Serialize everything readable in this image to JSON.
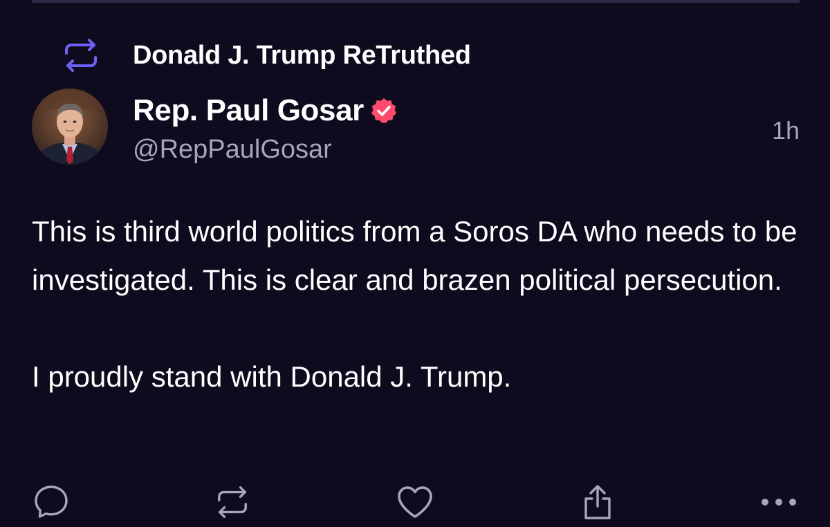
{
  "retruth": {
    "label": "Donald J. Trump ReTruthed",
    "icon": "retruth-icon",
    "icon_color": "#6e62f6"
  },
  "author": {
    "name": "Rep. Paul Gosar",
    "handle": "@RepPaulGosar",
    "verified": true,
    "verified_color": "#ff4a6c",
    "avatar": "avatar"
  },
  "post": {
    "timestamp": "1h",
    "paragraphs": [
      "This is third world politics from a Soros DA who needs to be investigated. This is clear and brazen political persecution.",
      "I proudly stand with Donald J. Trump."
    ]
  },
  "actions": [
    {
      "name": "reply",
      "icon": "comment-icon"
    },
    {
      "name": "retruth",
      "icon": "retruth-icon"
    },
    {
      "name": "like",
      "icon": "heart-icon"
    },
    {
      "name": "share",
      "icon": "share-icon"
    },
    {
      "name": "more",
      "icon": "more-icon"
    }
  ],
  "colors": {
    "background": "#0e0b1e",
    "text_primary": "#ffffff",
    "text_secondary": "#a7a5b8",
    "action_icon": "#a7a5b8"
  }
}
